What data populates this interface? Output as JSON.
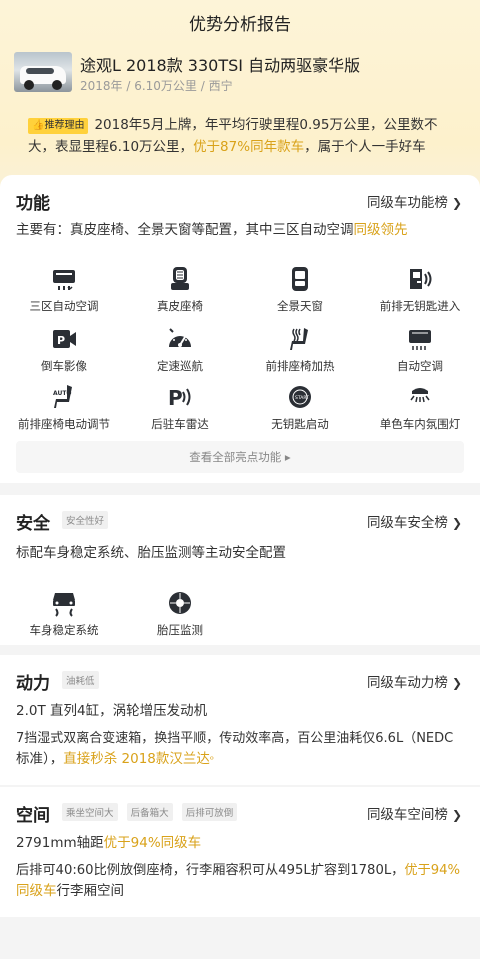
{
  "header": {
    "title": "优势分析报告"
  },
  "car": {
    "name": "途观L 2018款 330TSI 自动两驱豪华版",
    "meta": "2018年 / 6.10万公里 / 西宁"
  },
  "recommend": {
    "tag": "推荐理由",
    "line1": "2018年5月上牌，年平均行驶里程0.95万公里，公里数不",
    "line2_a": "大，表显里程6.10万公里，",
    "line2_hl": "优于87%同年款车",
    "line2_b": "，属于个人一手好车"
  },
  "features": {
    "title": "功能",
    "link": "同级车功能榜",
    "summary_a": "主要有：真皮座椅、全景天窗等配置，其中三区自动空调",
    "summary_hl": "同级领先",
    "items": [
      {
        "label": "三区自动空调",
        "icon": "climate-zone-icon"
      },
      {
        "label": "真皮座椅",
        "icon": "leather-seat-icon"
      },
      {
        "label": "全景天窗",
        "icon": "sunroof-icon"
      },
      {
        "label": "前排无钥匙进入",
        "icon": "keyless-entry-icon"
      },
      {
        "label": "倒车影像",
        "icon": "reverse-camera-icon"
      },
      {
        "label": "定速巡航",
        "icon": "cruise-control-icon"
      },
      {
        "label": "前排座椅加热",
        "icon": "seat-heating-icon"
      },
      {
        "label": "自动空调",
        "icon": "auto-ac-icon"
      },
      {
        "label": "前排座椅电动调节",
        "icon": "power-seat-icon"
      },
      {
        "label": "后驻车雷达",
        "icon": "parking-radar-icon"
      },
      {
        "label": "无钥匙启动",
        "icon": "keyless-start-icon"
      },
      {
        "label": "单色车内氛围灯",
        "icon": "ambient-light-icon"
      }
    ],
    "more": "查看全部亮点功能 ▸"
  },
  "safety": {
    "title": "安全",
    "pill": "安全性好",
    "link": "同级车安全榜",
    "summary": "标配车身稳定系统、胎压监测等主动安全配置",
    "items": [
      {
        "label": "车身稳定系统",
        "icon": "stability-control-icon"
      },
      {
        "label": "胎压监测",
        "icon": "tire-pressure-icon"
      }
    ]
  },
  "power": {
    "title": "动力",
    "pill": "油耗低",
    "link": "同级车动力榜",
    "line1": "2.0T 直列4缸，涡轮增压发动机",
    "line2": "7挡湿式双离合变速箱，换挡平顺，传动效率高，百公里油耗仅6.6L（NEDC",
    "line3_a": "标准），",
    "line3_hl": "直接秒杀 2018款汉兰达",
    "line3_icon": "search-icon"
  },
  "space": {
    "title": "空间",
    "pills": [
      "乘坐空间大",
      "后备箱大",
      "后排可放倒"
    ],
    "link": "同级车空间榜",
    "line1_a": "2791mm轴距",
    "line1_hl": "优于94%同级车",
    "line2_a": "后排可40:60比例放倒座椅，行李厢容积可从495L扩容到1780L，",
    "line2_hl": "优于94%",
    "line3_hl": "同级车",
    "line3_b": "行李厢空间"
  },
  "colors": {
    "accent": "#d9a21a",
    "tag": "#ffd13b",
    "icon": "#2b2f35"
  }
}
